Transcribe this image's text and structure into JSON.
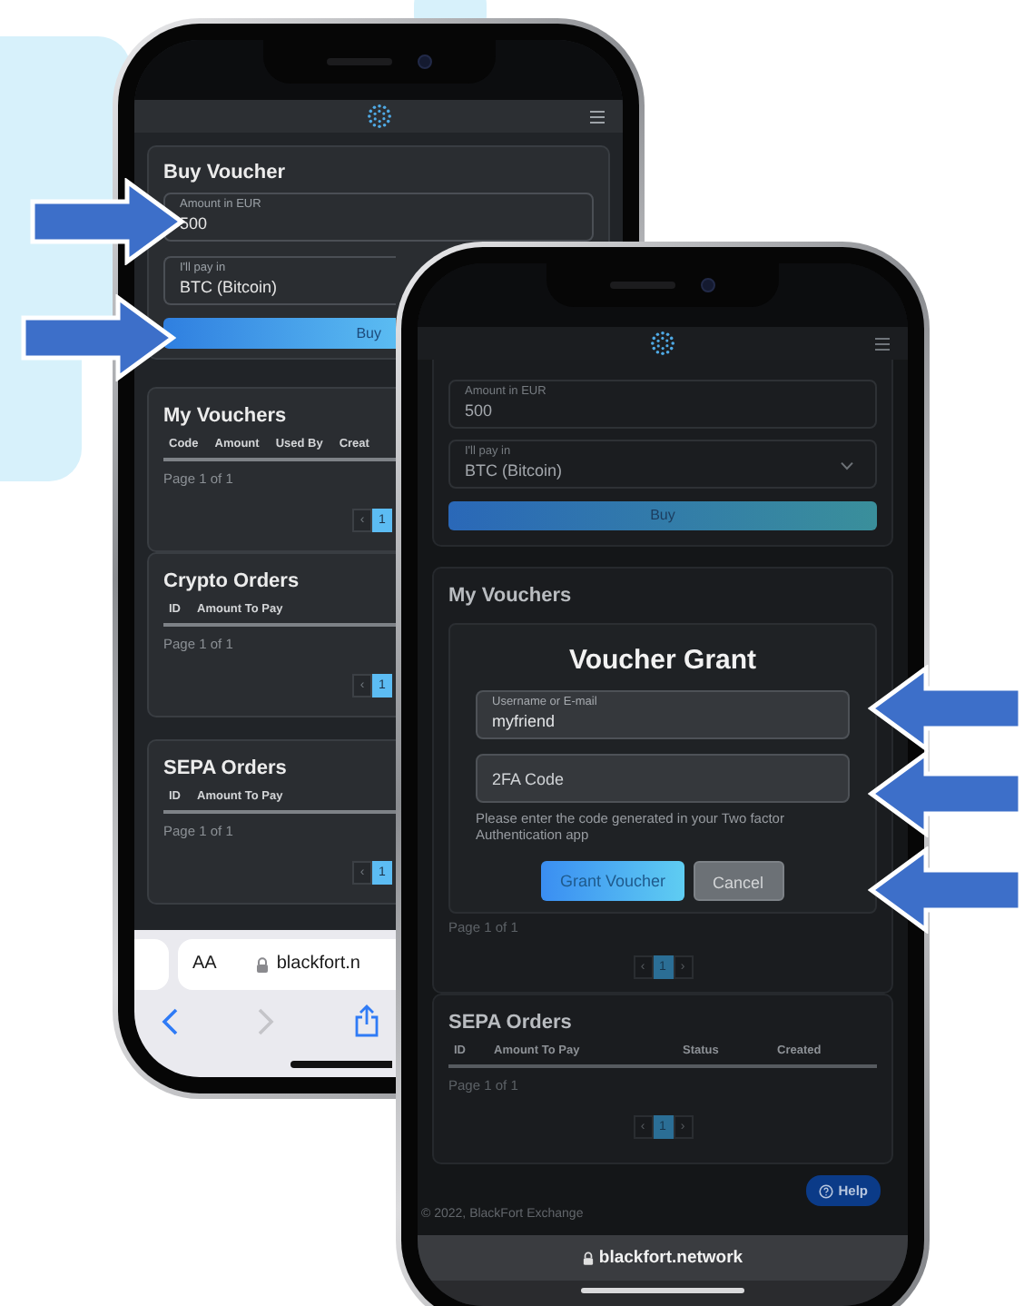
{
  "phone_back": {
    "buy_voucher": {
      "title": "Buy Voucher",
      "amount": {
        "label": "Amount in EUR",
        "value": "500"
      },
      "pay_with": {
        "label": "I'll pay in",
        "value": "BTC (Bitcoin)"
      },
      "button": "Buy"
    },
    "sections": [
      {
        "title": "My Vouchers",
        "columns": [
          "Code",
          "Amount",
          "Used By",
          "Creat"
        ],
        "page_info": "Page 1 of 1",
        "pagination": [
          {
            "label": "‹",
            "selected": false
          },
          {
            "label": "1",
            "selected": true
          }
        ]
      },
      {
        "title": "Crypto Orders",
        "columns": [
          "ID",
          "Amount To Pay"
        ],
        "page_info": "Page 1 of 1",
        "pagination": [
          {
            "label": "‹",
            "selected": false
          },
          {
            "label": "1",
            "selected": true
          }
        ]
      },
      {
        "title": "SEPA Orders",
        "columns": [
          "ID",
          "Amount To Pay"
        ],
        "page_info": "Page 1 of 1",
        "pagination": [
          {
            "label": "‹",
            "selected": false
          },
          {
            "label": "1",
            "selected": true
          }
        ]
      }
    ],
    "browser": {
      "text_size_button": "AA",
      "address": "blackfort.n"
    }
  },
  "phone_front": {
    "buy_voucher": {
      "amount": {
        "label": "Amount in EUR",
        "value": "500"
      },
      "pay_with": {
        "label": "I'll pay in",
        "value": "BTC (Bitcoin)"
      },
      "button": "Buy"
    },
    "sections": [
      {
        "title": "My Vouchers",
        "dialog": {
          "title": "Voucher Grant",
          "username": {
            "label": "Username or E-mail",
            "value": "myfriend"
          },
          "code": {
            "placeholder": "2FA Code"
          },
          "hint": "Please enter the code generated in your Two factor Authentication app",
          "buttons": [
            {
              "label": "Grant Voucher",
              "kind": "primary"
            },
            {
              "label": "Cancel",
              "kind": "secondary"
            }
          ]
        },
        "page_info": "Page 1 of 1",
        "pagination": [
          {
            "label": "‹",
            "selected": false
          },
          {
            "label": "1",
            "selected": true
          },
          {
            "label": "›",
            "selected": false
          }
        ]
      },
      {
        "title": "SEPA Orders",
        "columns": [
          "ID",
          "Amount To Pay",
          "Status",
          "Created"
        ],
        "page_info": "Page 1 of 1",
        "pagination": [
          {
            "label": "‹",
            "selected": false
          },
          {
            "label": "1",
            "selected": true
          },
          {
            "label": "›",
            "selected": false
          }
        ]
      }
    ],
    "help_button": "Help",
    "footer": "© 2022, BlackFort Exchange",
    "browser": {
      "address": "blackfort.network"
    }
  }
}
